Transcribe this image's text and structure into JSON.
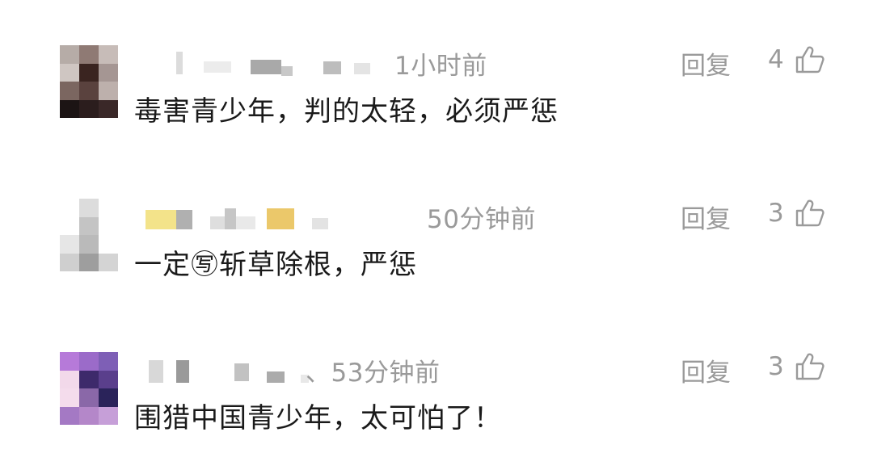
{
  "comments": [
    {
      "time": "1小时前",
      "reply_label": "回复",
      "likes": "4",
      "text": "毒害青少年，判的太轻，必须严惩"
    },
    {
      "time": "50分钟前",
      "reply_label": "回复",
      "likes": "3",
      "text": "一定㊢斩草除根，严惩"
    },
    {
      "time": "、53分钟前",
      "reply_label": "回复",
      "likes": "3",
      "text": "围猎中国青少年，太可怕了！"
    }
  ],
  "colors": {
    "meta_gray": "#9a9a9a",
    "text": "#1a1a1a",
    "background": "#ffffff"
  },
  "icons": {
    "like": "thumbs-up-icon"
  }
}
